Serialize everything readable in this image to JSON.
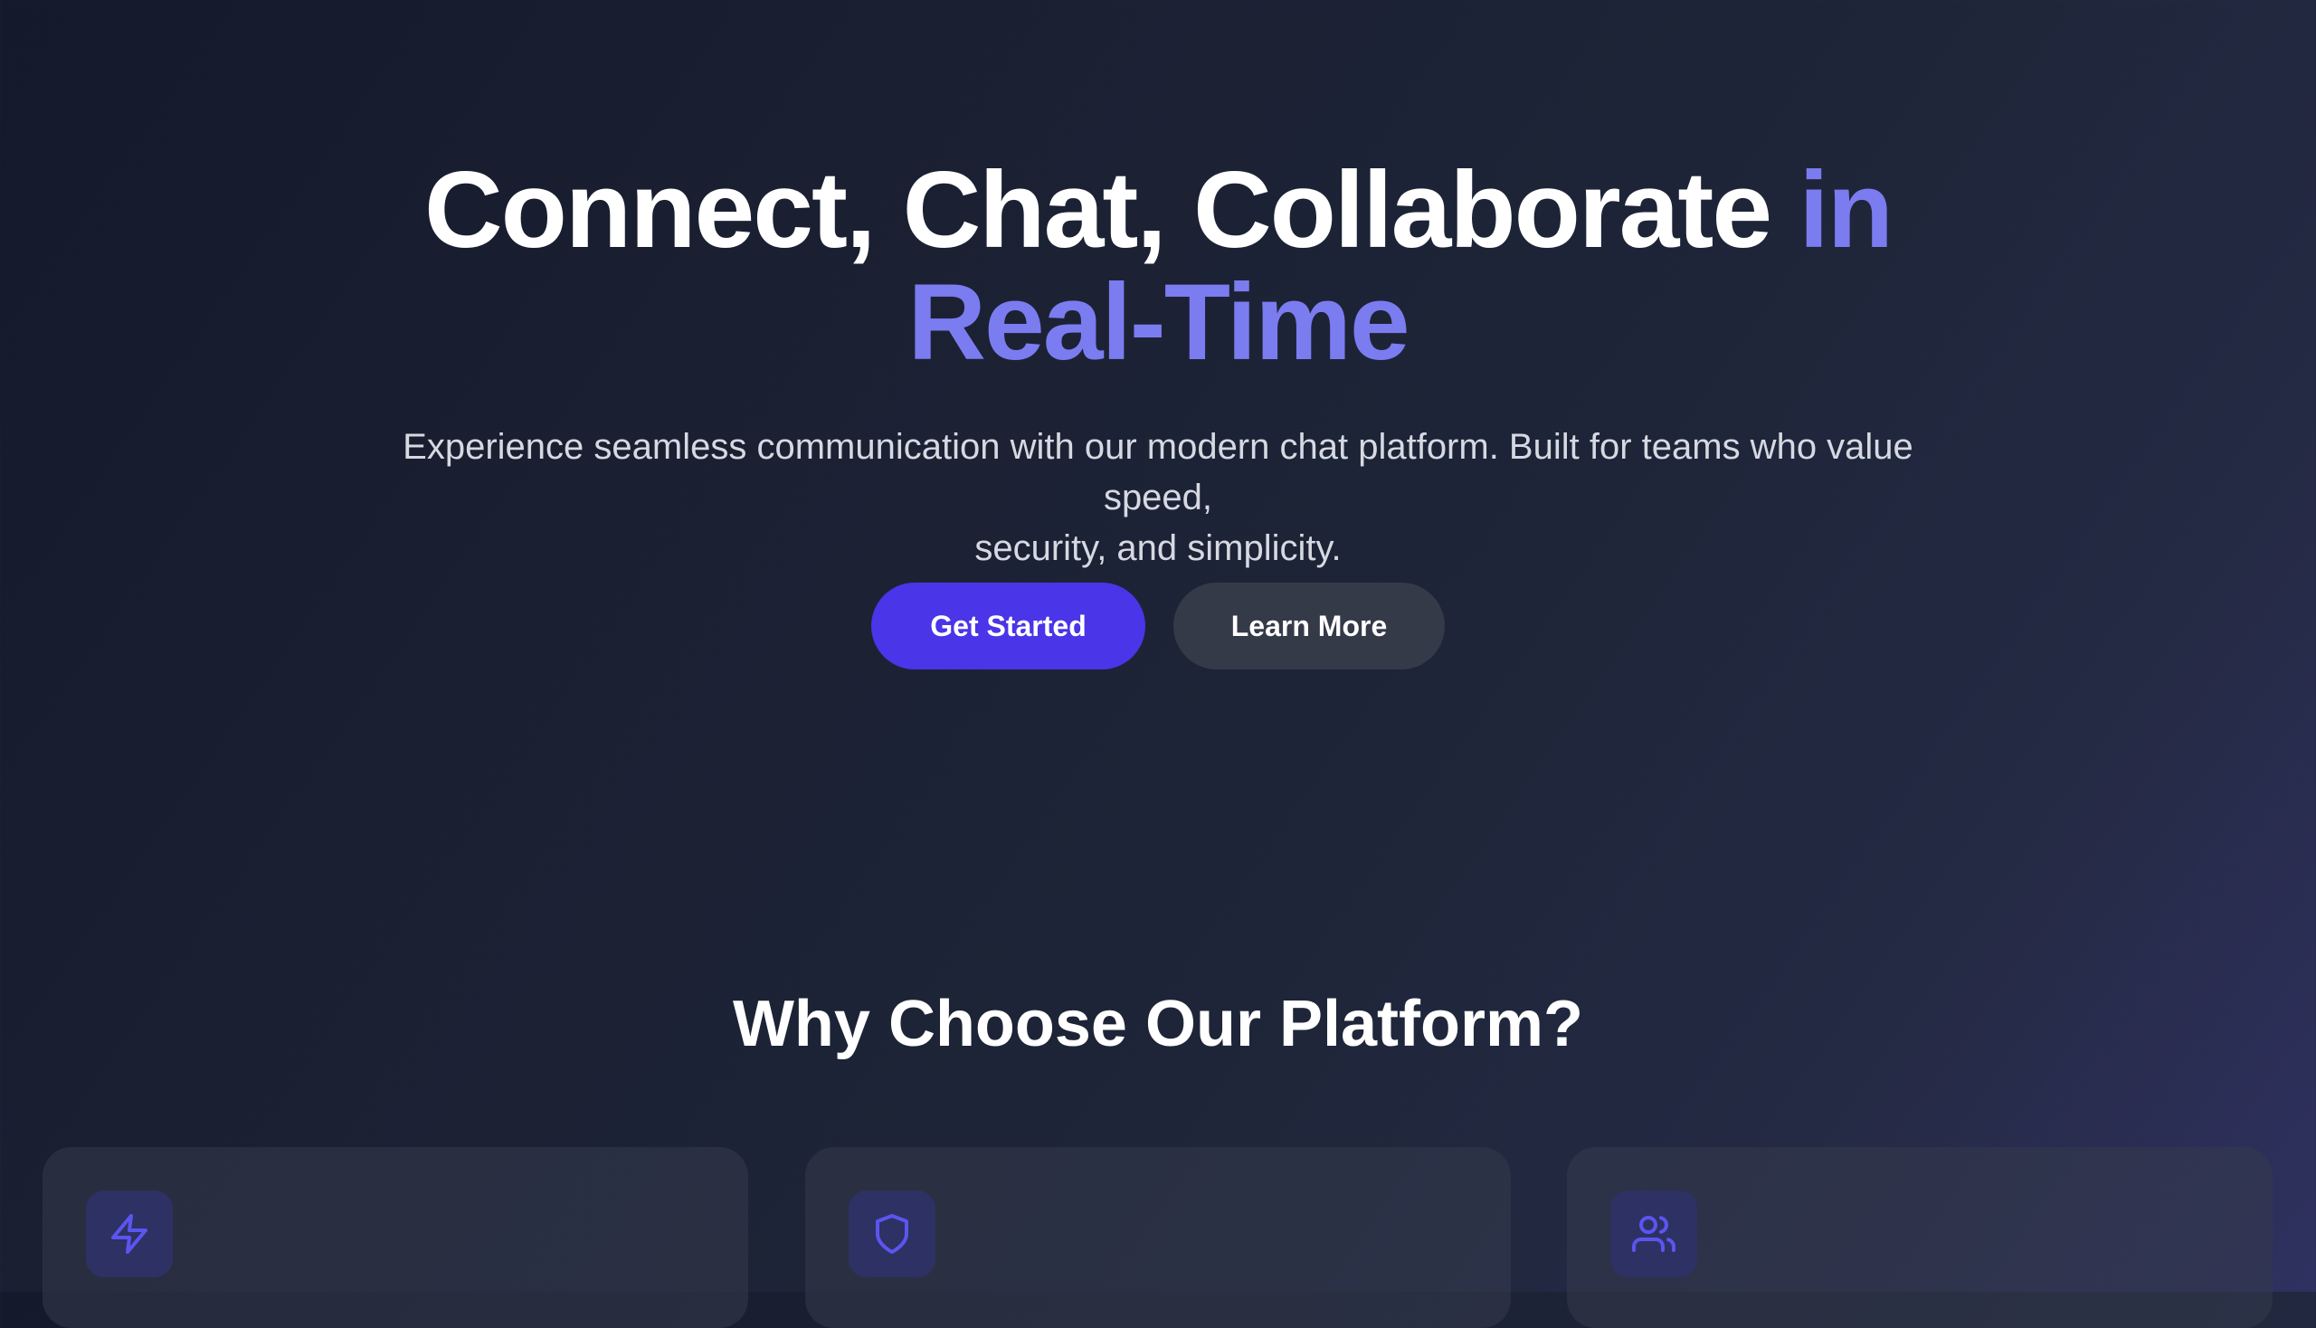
{
  "hero": {
    "title_main": "Connect, Chat, Collaborate",
    "title_accent_1": "in",
    "title_accent_2": "Real-Time",
    "subtitle_line1": "Experience seamless communication with our modern chat platform. Built for teams who value speed,",
    "subtitle_line2": "security, and simplicity.",
    "primary_button": "Get Started",
    "secondary_button": "Learn More"
  },
  "features": {
    "title": "Why Choose Our Platform?",
    "cards": [
      {
        "icon": "lightning-icon"
      },
      {
        "icon": "shield-icon"
      },
      {
        "icon": "users-icon"
      }
    ]
  },
  "colors": {
    "accent": "#7b7cf0",
    "primary_button": "#4a35e8",
    "secondary_button": "#353a49",
    "icon_stroke": "#5b55f0"
  }
}
